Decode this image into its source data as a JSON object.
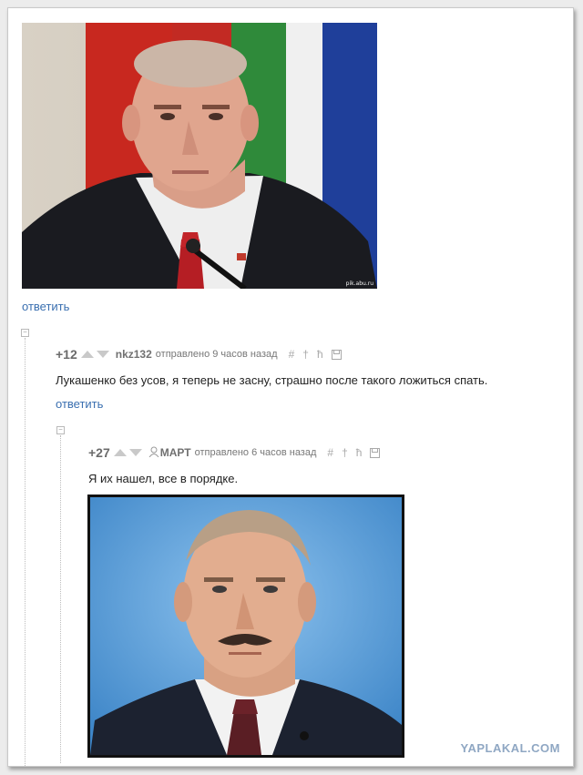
{
  "post": {
    "top_image": {
      "alt": "",
      "watermark": "pik.abu.ru"
    },
    "reply_label": "ответить"
  },
  "comments": [
    {
      "score": "+12",
      "author": "nkz132",
      "sent": "отправлено 9 часов назад",
      "tools": [
        "#",
        "†",
        "ħ",
        "💾"
      ],
      "text": "Лукашенко без усов, я теперь не засну, страшно после такого ложиться спать.",
      "reply_label": "ответить",
      "collapse": "−"
    },
    {
      "score": "+27",
      "author": "МАРТ",
      "sent": "отправлено 6 часов назад",
      "tools": [
        "#",
        "†",
        "ħ",
        "💾"
      ],
      "text": "Я их нашел, все в порядке.",
      "collapse": "−"
    }
  ],
  "footer": {
    "site_logo": "YAPLAKAL.COM"
  },
  "colors": {
    "link": "#3a6fb0",
    "vote_arrow": "#c9c9c9",
    "score": "#6b6b6b",
    "logo": "#8fa7c3"
  }
}
